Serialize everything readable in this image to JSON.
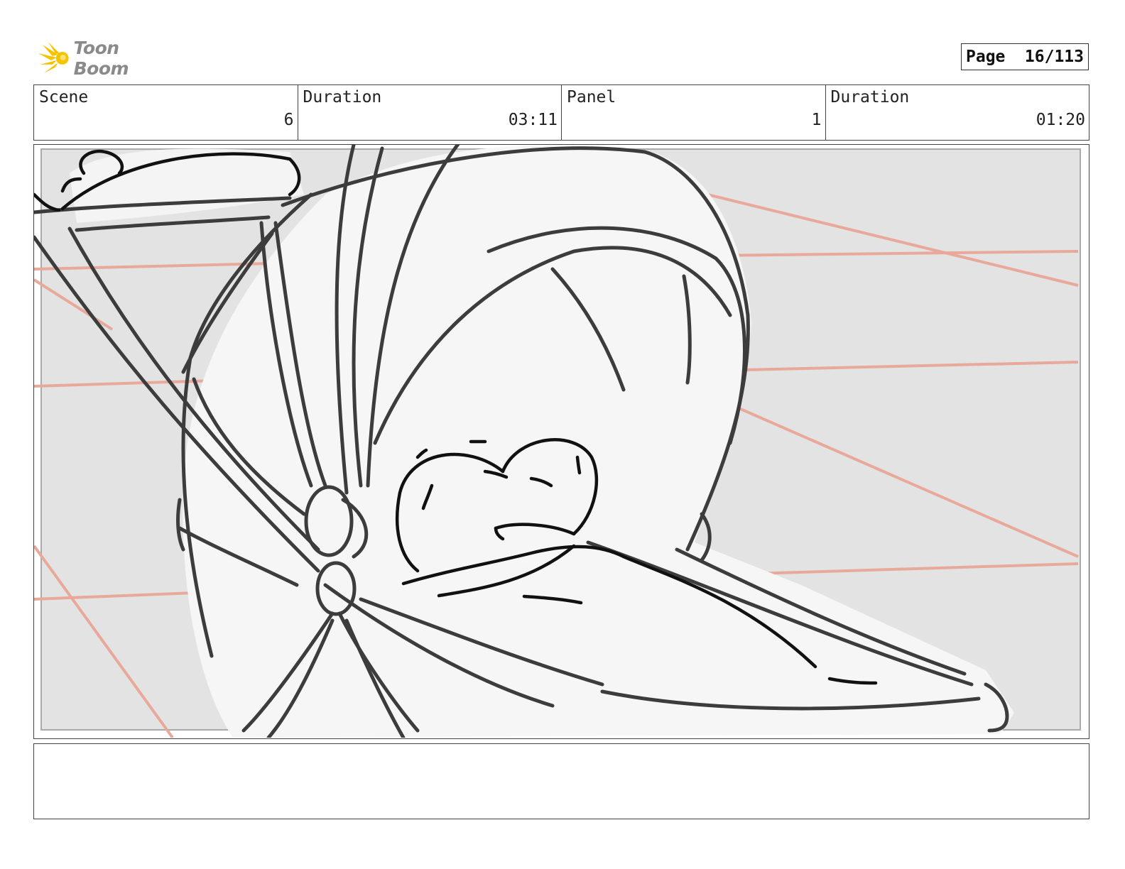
{
  "brand": {
    "logo_text": "Toon Boom"
  },
  "page": {
    "label": "Page",
    "number": "16/113"
  },
  "info": {
    "scene_label": "Scene",
    "scene_value": "6",
    "scene_duration_label": "Duration",
    "scene_duration_value": "03:11",
    "panel_label": "Panel",
    "panel_value": "1",
    "panel_duration_label": "Duration",
    "panel_duration_value": "01:20"
  },
  "notes": {
    "text": ""
  },
  "colors": {
    "background_gray": "#e3e3e3",
    "sketch_fill": "#f6f6f6",
    "guide_red": "#e8a89a",
    "stroke_dark": "#3c3c3c",
    "logo_yellow": "#f5c400"
  }
}
